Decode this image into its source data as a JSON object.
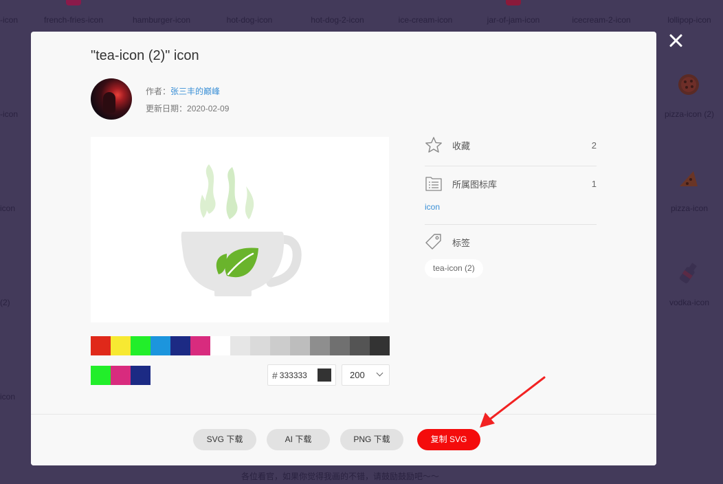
{
  "background": {
    "top_labels": [
      "-icon",
      "french-fries-icon",
      "hamburger-icon",
      "hot-dog-icon",
      "hot-dog-2-icon",
      "ice-cream-icon",
      "jar-of-jam-icon",
      "icecream-2-icon",
      "lollipop-icon"
    ],
    "left_labels": [
      "-icon",
      "icon",
      "(2)",
      "icon"
    ],
    "right_items": [
      {
        "label": "pizza-icon (2)",
        "icon": "pizza-icon"
      },
      {
        "label": "pizza-icon",
        "icon": "pizza-slice-icon"
      },
      {
        "label": "vodka-icon",
        "icon": "vodka-bottle-icon"
      }
    ],
    "footer_text": "各位看官，如果你觉得我画的不错，请鼓励鼓励吧～～"
  },
  "modal": {
    "title": "\"tea-icon (2)\" icon",
    "author_label": "作者：",
    "author_name": "张三丰的巅峰",
    "updated_label": "更新日期：",
    "updated_date": "2020-02-09",
    "preview_icon": "tea-cup-icon",
    "palette_row1": [
      "#e0291a",
      "#f7e932",
      "#22ee2a",
      "#1c95dd",
      "#1c2a84",
      "#d82b7e",
      "#ffffff",
      "#e6e6e6",
      "#dadada",
      "#cccccc",
      "#bdbdbd",
      "#8e8e8e",
      "#707070",
      "#545454",
      "#333333"
    ],
    "palette_row2": [
      "#22ee2a",
      "#d82b7e",
      "#1c2a84"
    ],
    "hex_prefix": "#",
    "hex_value": "333333",
    "hex_chip_color": "#333333",
    "size_value": "200",
    "favorites_label": "收藏",
    "favorites_count": "2",
    "library_label": "所属图标库",
    "library_count": "1",
    "library_link": "icon",
    "tags_label": "标签",
    "tag_value": "tea-icon (2)",
    "buttons": {
      "svg_download": "SVG 下载",
      "ai_download": "AI 下载",
      "png_download": "PNG 下载",
      "copy_svg": "复制 SVG"
    },
    "accent_red": "#f40c0c",
    "link_blue": "#3a8fd6"
  }
}
